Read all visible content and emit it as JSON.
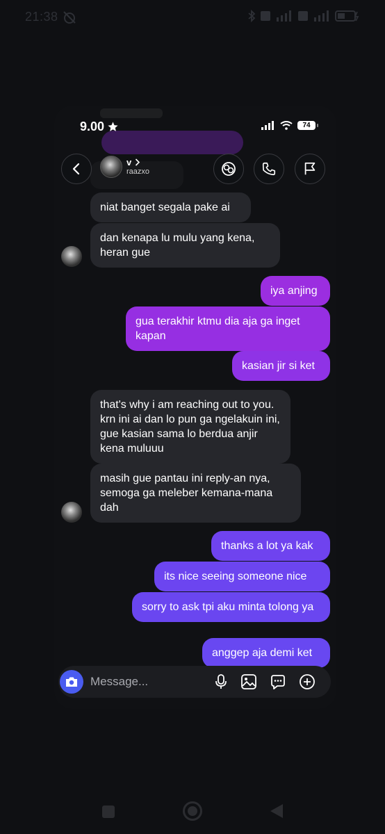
{
  "device_status": {
    "time": "21:38"
  },
  "app_status": {
    "time": "9.00",
    "battery": "74"
  },
  "header": {
    "contact_name": "v",
    "contact_handle": "raazxo"
  },
  "messages": [
    {
      "direction": "received",
      "text": "niat banget segala pake ai"
    },
    {
      "direction": "received",
      "text": "dan kenapa lu mulu yang kena, heran gue"
    },
    {
      "direction": "sent",
      "text": "iya anjing"
    },
    {
      "direction": "sent",
      "text": "gua terakhir ktmu dia aja ga inget kapan"
    },
    {
      "direction": "sent",
      "text": "kasian jir si ket"
    },
    {
      "direction": "received",
      "text": "that's why i am reaching out to you. krn ini ai dan lo pun ga ngelakuin ini, gue kasian sama lo berdua anjir kena muluuu"
    },
    {
      "direction": "received",
      "text": "masih gue pantau ini reply-an nya, semoga ga meleber kemana-mana dah"
    },
    {
      "direction": "sent",
      "text": "thanks a lot ya kak"
    },
    {
      "direction": "sent",
      "text": "its nice seeing someone nice"
    },
    {
      "direction": "sent",
      "text": "sorry to ask tpi aku minta tolong ya"
    },
    {
      "direction": "sent",
      "text": "anggep aja demi ket"
    }
  ],
  "composer": {
    "placeholder": "Message..."
  },
  "colors": {
    "sent_purple": "#9b2ee0",
    "sent_indigo": "#6a45f0",
    "received": "#26272c",
    "camera_button": "#4a5cf0"
  },
  "icons": [
    "back-icon",
    "effects-icon",
    "phone-icon",
    "flag-icon",
    "camera-icon",
    "microphone-icon",
    "gallery-icon",
    "sticker-icon",
    "plus-icon"
  ]
}
